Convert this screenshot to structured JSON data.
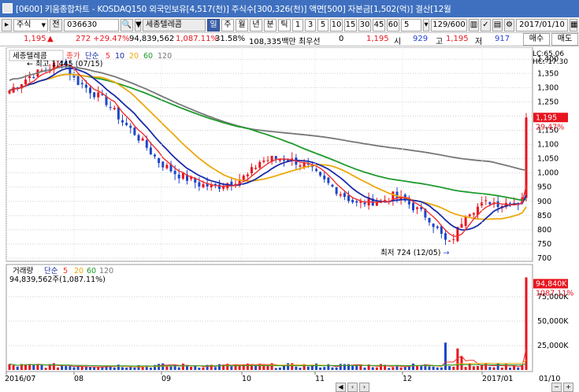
{
  "window": {
    "title": "[0600] 키움종합차트 - KOSDAQ150 외국인보유[4,517(천)] 주식수[300,326(천)] 액면[500] 자본금[1,502(억)] 결산[12월",
    "buttons": [
      "?",
      "_",
      "□",
      "×"
    ]
  },
  "toolbar": {
    "market": "주식",
    "prev_label": "전",
    "code": "036630",
    "search_icon": "magnifier-icon",
    "stock_name": "세종텔레콤",
    "period_buttons": [
      "일",
      "주",
      "월",
      "년",
      "분",
      "틱"
    ],
    "selected_period": "일",
    "intervals": [
      "1",
      "3",
      "5",
      "10",
      "15",
      "30",
      "45",
      "60"
    ],
    "interval_value": "5",
    "count": "129/600",
    "date": "2017/01/10"
  },
  "quote": {
    "price": "1,195",
    "change": "272",
    "change_pct": "+29.47%",
    "volume": "94,839,562",
    "volume_pct": "1,087.11%",
    "turnover": "31.58%",
    "amount": "108,335백만",
    "best_label": "최우선",
    "best_qty": "0",
    "best_price": "1,195",
    "open_label": "시",
    "open": "929",
    "high_label": "고",
    "high": "1,195",
    "low_label": "저",
    "low": "917",
    "sell_label": "매수",
    "buy_label": "매도"
  },
  "chart_data": {
    "type": "candlestick",
    "legend_price": [
      "세종텔레콤",
      "종가",
      "단순",
      "5",
      "10",
      "20",
      "60",
      "120"
    ],
    "legend_volume": [
      "거래량",
      "단순",
      "5",
      "20",
      "60",
      "120"
    ],
    "volume_label": "94,839,562주(1,087.11%)",
    "high_annot": "최고 1,445 (07/15)",
    "low_annot": "최저 724 (12/05)",
    "lc": "LC:65.06",
    "hc": "HC:-17.30",
    "price_ylim": [
      700,
      1420
    ],
    "price_ticks": [
      "1,400",
      "1,350",
      "1,300",
      "1,250",
      "1,200",
      "1,150",
      "1,100",
      "1,050",
      "1,000",
      "950",
      "900",
      "850",
      "800",
      "750",
      "700"
    ],
    "current_price_label": "1,195",
    "current_pct_label": "29.47%",
    "volume_ticks": [
      "75,000K",
      "50,000K",
      "25,000K"
    ],
    "volume_current_label": "94,840K",
    "volume_pct_label": "1087.11%",
    "x_labels": [
      "2016/07",
      "08",
      "09",
      "10",
      "11",
      "12",
      "2017/01",
      "01/10"
    ],
    "colors": {
      "up": "#e8141e",
      "down": "#1e46c8",
      "ma5": "#f23030",
      "ma10": "#1a2ba8",
      "ma20": "#eba90d",
      "ma60": "#1f9b2e",
      "ma120": "#777777"
    }
  }
}
